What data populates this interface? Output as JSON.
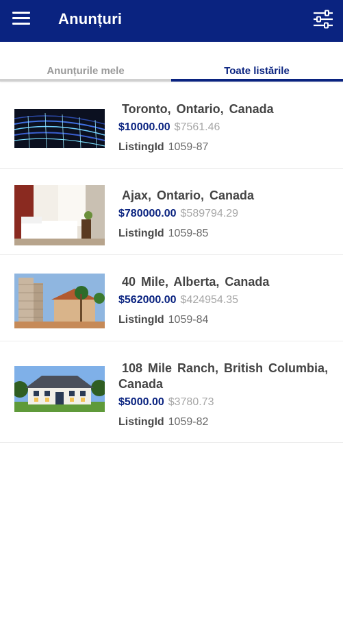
{
  "app": {
    "title": "Anunțuri"
  },
  "icons": {
    "menu": "hamburger-icon",
    "filter": "sliders-icon"
  },
  "colors": {
    "primary": "#0a2380",
    "muted": "#a6a6a6"
  },
  "tabs": [
    {
      "label": "Anunțurile mele",
      "active": false
    },
    {
      "label": "Toate listările",
      "active": true
    }
  ],
  "listings": [
    {
      "location": "Toronto,  Ontario,  Canada",
      "price": "$10000.00",
      "old_price": "$7561.46",
      "listing_label": "ListingId",
      "listing_id": "1059-87"
    },
    {
      "location": "Ajax,  Ontario,  Canada",
      "price": "$780000.00",
      "old_price": "$589794.29",
      "listing_label": "ListingId",
      "listing_id": "1059-85"
    },
    {
      "location": "40 Mile,  Alberta,  Canada",
      "price": "$562000.00",
      "old_price": "$424954.35",
      "listing_label": "ListingId",
      "listing_id": "1059-84"
    },
    {
      "location": "108 Mile Ranch,  British Columbia,  Canada",
      "price": "$5000.00",
      "old_price": "$3780.73",
      "listing_label": "ListingId",
      "listing_id": "1059-82"
    }
  ]
}
